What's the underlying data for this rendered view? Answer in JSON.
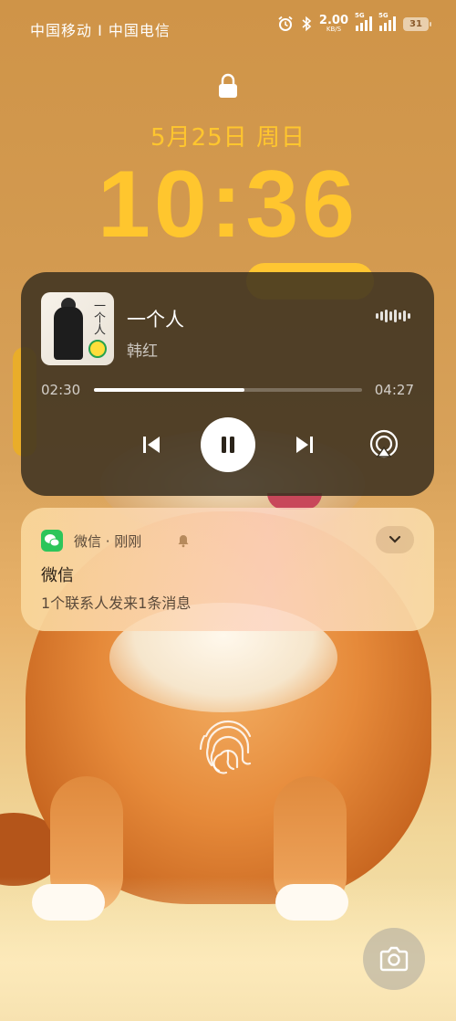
{
  "status": {
    "carrier": "中国移动 I 中国电信",
    "net_speed": "2.00",
    "net_unit": "KB/S",
    "sim1_tag": "5G",
    "sim2_tag": "5G",
    "battery": "31"
  },
  "lock": {
    "date": "5月25日 周日",
    "time": "10:36"
  },
  "media": {
    "song": "一个人",
    "artist": "韩红",
    "album_glyph": "一个人",
    "current_time": "02:30",
    "total_time": "04:27",
    "progress": 0.5618
  },
  "notification": {
    "app_line": "微信 · 刚刚",
    "title": "微信",
    "body": "1个联系人发来1条消息"
  },
  "colors": {
    "clock": "#ffc62e",
    "media_bg": "#3a3020",
    "wechat": "#2dc55a"
  }
}
